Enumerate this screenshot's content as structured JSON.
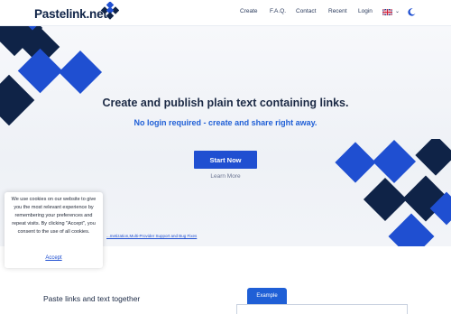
{
  "brand": {
    "name": "Pastelink.net"
  },
  "nav": {
    "items": [
      "Create",
      "F.A.Q.",
      "Contact",
      "Recent",
      "Login"
    ],
    "language_icon": "uk-flag-icon",
    "chevron_icon": "chevron-down-icon",
    "theme_icon": "moon-icon"
  },
  "hero": {
    "title": "Create and publish plain text containing links.",
    "subtitle": "No login required - create and share right away.",
    "cta_label": "Start Now",
    "learn_more": "Learn More",
    "news_link": "...metization,Multi-Provider Support and Bug Fixes"
  },
  "cookie": {
    "text": "We use cookies on our website to give you the most relevant experience by remembering your preferences and repeat visits. By clicking \"Accept\", you consent to the use of all cookies.",
    "accept": "Accept"
  },
  "features": {
    "title": "Paste links and text together",
    "example_tab": "Example"
  },
  "colors": {
    "accent": "#1f4fd1",
    "accent_light": "#1f5fd6",
    "navy": "#0f2347"
  }
}
